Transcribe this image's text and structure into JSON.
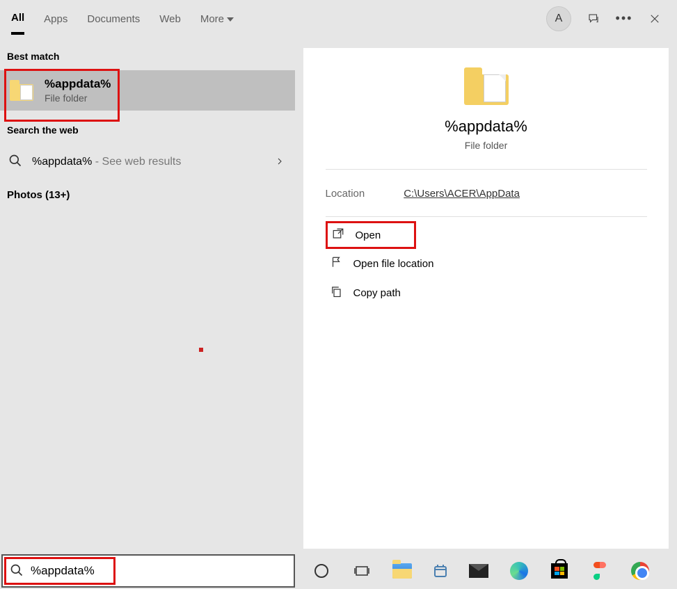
{
  "header": {
    "tabs": {
      "all": "All",
      "apps": "Apps",
      "documents": "Documents",
      "web": "Web",
      "more": "More"
    },
    "avatar_letter": "A"
  },
  "left": {
    "best_match_heading": "Best match",
    "best_match": {
      "title": "%appdata%",
      "subtitle": "File folder"
    },
    "search_web_heading": "Search the web",
    "web_result": {
      "query": "%appdata%",
      "hint": " - See web results"
    },
    "photos_heading": "Photos (13+)"
  },
  "preview": {
    "title": "%appdata%",
    "subtitle": "File folder",
    "location_label": "Location",
    "location_value": "C:\\Users\\ACER\\AppData",
    "actions": {
      "open": "Open",
      "open_location": "Open file location",
      "copy_path": "Copy path"
    }
  },
  "searchbox": {
    "value": "%appdata%"
  }
}
